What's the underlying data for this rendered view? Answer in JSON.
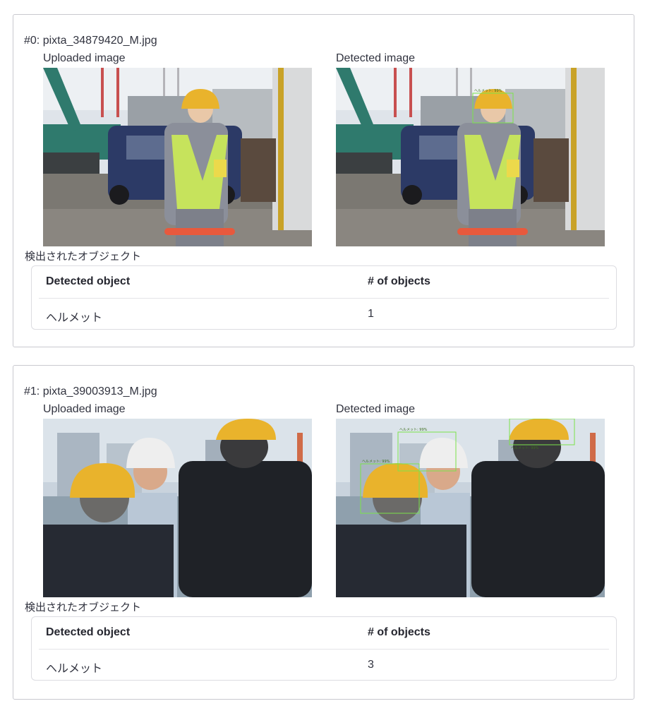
{
  "results": [
    {
      "title": "#0: pixta_34879420_M.jpg",
      "uploaded_label": "Uploaded image",
      "detected_label": "Detected image",
      "objects_section_label": "検出されたオブジェクト",
      "table": {
        "headers": [
          "Detected object",
          "# of objects"
        ],
        "rows": [
          {
            "object": "ヘルメット",
            "count": "1"
          }
        ]
      },
      "detections": [
        {
          "label": "ヘルメット: 99%"
        }
      ]
    },
    {
      "title": "#1: pixta_39003913_M.jpg",
      "uploaded_label": "Uploaded image",
      "detected_label": "Detected image",
      "objects_section_label": "検出されたオブジェクト",
      "table": {
        "headers": [
          "Detected object",
          "# of objects"
        ],
        "rows": [
          {
            "object": "ヘルメット",
            "count": "3"
          }
        ]
      },
      "detections": [
        {
          "label": "ヘルメット: 99%"
        },
        {
          "label": "ヘルメット: 99%"
        },
        {
          "label": "ヘルメット: 99%"
        }
      ]
    }
  ],
  "colors": {
    "detection_box": "#7be34a",
    "helmet_yellow": "#e9b32c",
    "helmet_white": "#eeeeee",
    "vest": "#c6e35c",
    "van": "#2c3a66",
    "suit": "#1f2227"
  }
}
